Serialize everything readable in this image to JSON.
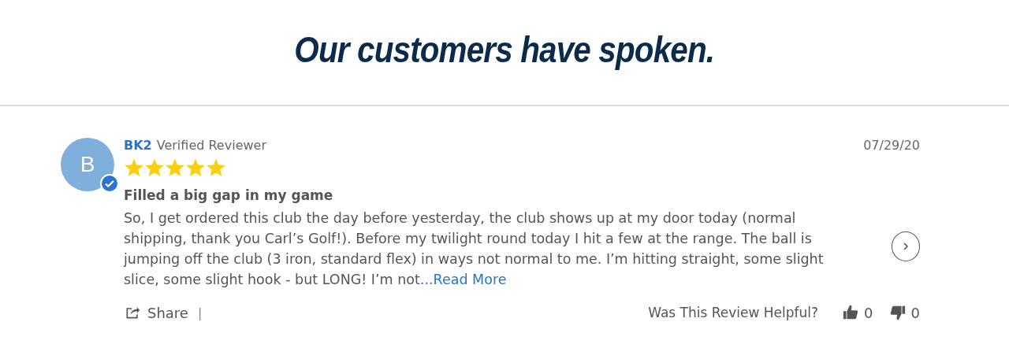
{
  "heading": "Our customers have spoken.",
  "review": {
    "avatar_letter": "B",
    "verified": true,
    "author": "BK2",
    "author_badge": "Verified Reviewer",
    "date": "07/29/20",
    "stars": 5,
    "title": "Filled a big gap in my game",
    "body": "So, I get ordered this club the day before yesterday, the club shows up at my door today (normal shipping, thank you Carl’s Golf!). Before my twilight round today I hit a few at the range. The ball is jumping off the club (3 iron, standard flex) in ways not normal to me. I’m hitting straight, some slight slice, some slight hook - but LONG! I’m not",
    "read_more": "...Read More",
    "share": "Share",
    "separator": "|",
    "helpful_prompt": "Was This Review Helpful?",
    "up_votes": "0",
    "down_votes": "0"
  }
}
